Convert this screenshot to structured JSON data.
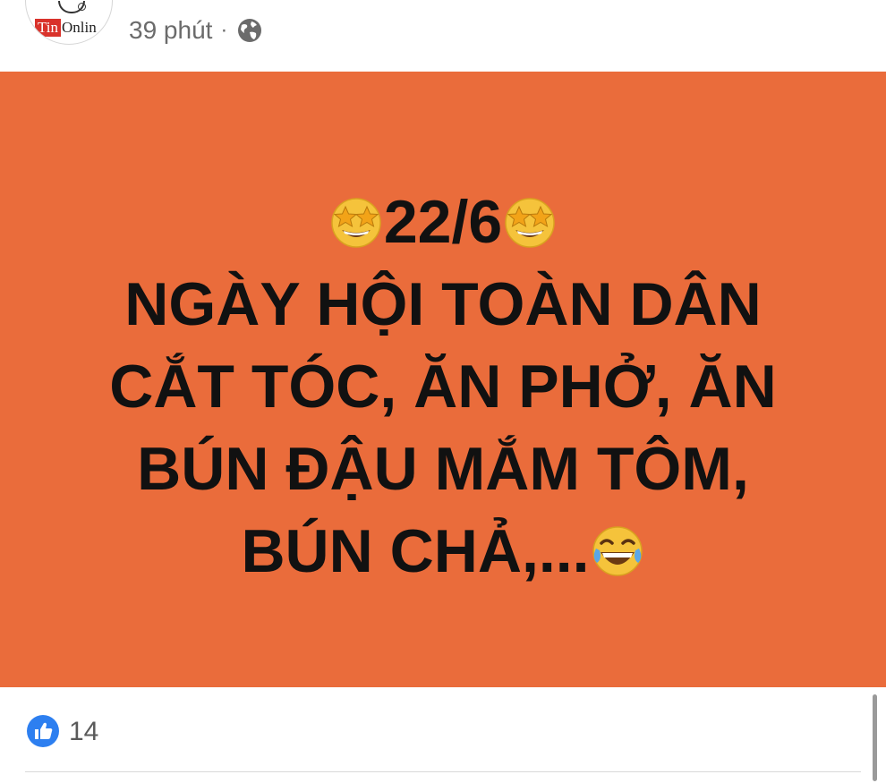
{
  "post": {
    "author_logo": {
      "tin": "Tin",
      "onlin": "Onlin"
    },
    "time": "39 phút",
    "separator": "·",
    "privacy_icon": "globe-icon"
  },
  "status": {
    "background_color": "#ea6c3b",
    "text_color": "#111111",
    "lines": [
      "22/6",
      "NGÀY HỘI TOÀN DÂN",
      "CẮT TÓC, ĂN PHỞ, ĂN",
      "BÚN ĐẬU MẮM TÔM,",
      "BÚN CHẢ,..."
    ],
    "emojis": [
      "star-struck-emoji",
      "star-struck-emoji",
      "tears-of-joy-emoji"
    ]
  },
  "reactions": {
    "icon": "like-icon",
    "count": "14"
  }
}
